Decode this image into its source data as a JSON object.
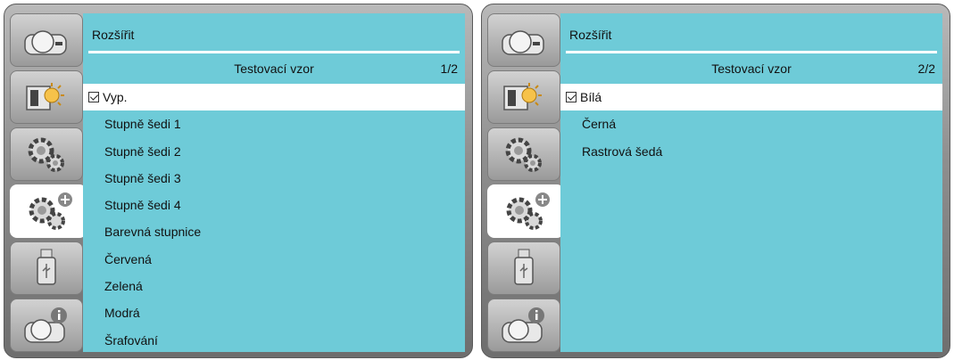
{
  "panels": [
    {
      "title": "Rozšířit",
      "subtitle": "Testovací vzor",
      "page": "1/2",
      "items": [
        {
          "label": "Vyp.",
          "selected": true
        },
        {
          "label": "Stupně šedi 1",
          "selected": false
        },
        {
          "label": "Stupně šedi 2",
          "selected": false
        },
        {
          "label": "Stupně šedi 3",
          "selected": false
        },
        {
          "label": "Stupně šedi 4",
          "selected": false
        },
        {
          "label": "Barevná stupnice",
          "selected": false
        },
        {
          "label": "Červená",
          "selected": false
        },
        {
          "label": "Zelená",
          "selected": false
        },
        {
          "label": "Modrá",
          "selected": false
        },
        {
          "label": "Šrafování",
          "selected": false
        }
      ]
    },
    {
      "title": "Rozšířit",
      "subtitle": "Testovací vzor",
      "page": "2/2",
      "items": [
        {
          "label": "Bílá",
          "selected": true
        },
        {
          "label": "Černá",
          "selected": false
        },
        {
          "label": "Rastrová šedá",
          "selected": false
        }
      ]
    }
  ],
  "sidebar_tabs": [
    {
      "icon": "projector-icon",
      "active": false
    },
    {
      "icon": "image-adjust-icon",
      "active": false
    },
    {
      "icon": "settings-icon",
      "active": false
    },
    {
      "icon": "extended-settings-icon",
      "active": true
    },
    {
      "icon": "usb-icon",
      "active": false
    },
    {
      "icon": "info-icon",
      "active": false
    }
  ],
  "colors": {
    "content_bg": "#6ecbd8",
    "selected_row_bg": "#ffffff",
    "frame": "#8e8e8e"
  }
}
